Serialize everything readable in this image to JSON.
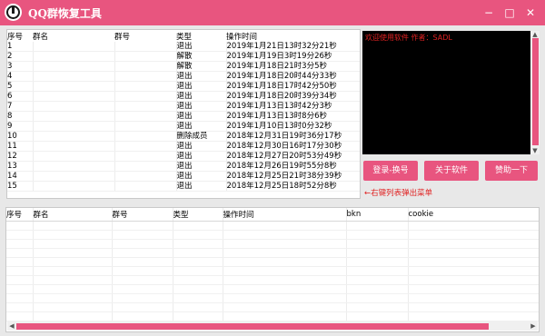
{
  "app": {
    "title": "QQ群恢复工具"
  },
  "window_controls": {
    "minimize": "−",
    "maximize": "□",
    "close": "✕"
  },
  "top_table": {
    "columns": [
      "序号",
      "群名",
      "群号",
      "类型",
      "操作时间"
    ],
    "rows": [
      [
        "1",
        "",
        "",
        "退出",
        "2019年1月21日13时32分21秒"
      ],
      [
        "2",
        "",
        "",
        "解散",
        "2019年1月19日3时19分26秒"
      ],
      [
        "3",
        "",
        "",
        "解散",
        "2019年1月18日21时3分5秒"
      ],
      [
        "4",
        "",
        "",
        "退出",
        "2019年1月18日20时44分33秒"
      ],
      [
        "5",
        "",
        "",
        "退出",
        "2019年1月18日17时42分50秒"
      ],
      [
        "6",
        "",
        "",
        "退出",
        "2019年1月18日20时39分34秒"
      ],
      [
        "7",
        "",
        "",
        "退出",
        "2019年1月13日13时42分3秒"
      ],
      [
        "8",
        "",
        "",
        "退出",
        "2019年1月13日13时8分6秒"
      ],
      [
        "9",
        "",
        "",
        "退出",
        "2019年1月10日13时0分32秒"
      ],
      [
        "10",
        "",
        "",
        "删除成员",
        "2018年12月31日19时36分17秒"
      ],
      [
        "11",
        "",
        "",
        "退出",
        "2018年12月30日16时17分30秒"
      ],
      [
        "12",
        "",
        "",
        "退出",
        "2018年12月27日20时53分49秒"
      ],
      [
        "13",
        "",
        "",
        "退出",
        "2018年12月26日19时55分8秒"
      ],
      [
        "14",
        "",
        "",
        "退出",
        "2018年12月25日21时38分39秒"
      ],
      [
        "15",
        "",
        "",
        "退出",
        "2018年12月25日18时52分8秒"
      ]
    ]
  },
  "console": {
    "text": "欢迎使用软件 作者：SADL"
  },
  "buttons": {
    "login": "登录-换号",
    "about": "关于软件",
    "sponsor": "赞助一下"
  },
  "hint": "←右键列表弹出菜单",
  "bottom_table": {
    "columns": [
      "序号",
      "群名",
      "群号",
      "类型",
      "操作时间",
      "bkn",
      "cookie"
    ],
    "rows": [
      [
        "",
        "",
        "",
        "",
        "",
        "",
        ""
      ],
      [
        "",
        "",
        "",
        "",
        "",
        "",
        ""
      ],
      [
        "",
        "",
        "",
        "",
        "",
        "",
        ""
      ],
      [
        "",
        "",
        "",
        "",
        "",
        "",
        ""
      ],
      [
        "",
        "",
        "",
        "",
        "",
        "",
        ""
      ],
      [
        "",
        "",
        "",
        "",
        "",
        "",
        ""
      ],
      [
        "",
        "",
        "",
        "",
        "",
        "",
        ""
      ],
      [
        "",
        "",
        "",
        "",
        "",
        "",
        ""
      ],
      [
        "",
        "",
        "",
        "",
        "",
        "",
        ""
      ],
      [
        "",
        "",
        "",
        "",
        "",
        "",
        ""
      ],
      [
        "",
        "",
        "",
        "",
        "",
        "",
        ""
      ]
    ]
  },
  "colors": {
    "accent": "#e8557f",
    "console_bg": "#000000",
    "console_text": "#e02222"
  }
}
